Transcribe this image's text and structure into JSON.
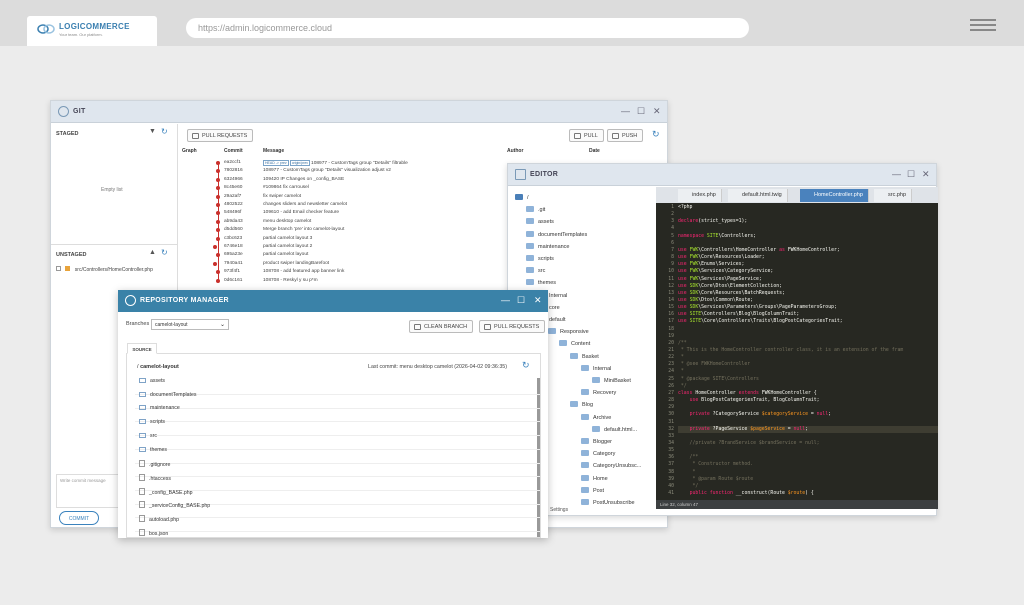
{
  "browser": {
    "logo": "LOGICOMMERCE",
    "logo_sub": "Your team. Our platform.",
    "url": "https://admin.logicommerce.cloud"
  },
  "git": {
    "title": "GIT",
    "staged": "STAGED",
    "empty": "Empty list",
    "unstaged": "UNSTAGED",
    "unstaged_file": "src/Controllers/HomeController.php",
    "commit_placeholder": "Write commit message",
    "commit_button": "COMMIT",
    "pull_requests": "PULL REQUESTS",
    "pull": "PULL",
    "push": "PUSH",
    "columns": [
      "Graph",
      "Commit",
      "Message",
      "Author",
      "Date"
    ],
    "commits": [
      {
        "hash": "ea2ccf1",
        "tags": [
          "HEAD -> prev",
          "origin/prev"
        ],
        "msg": "108977 - CustomTags group \"Details\" filtrable"
      },
      {
        "hash": "7802816",
        "tags": [],
        "msg": "108977 - CustomTags group \"Details\" visualization adjust v2"
      },
      {
        "hash": "6324966",
        "tags": [],
        "msg": "109420 IP Changes on _config_BASE"
      },
      {
        "hash": "8c45e60",
        "tags": [],
        "msg": "#109864 fix carrousel"
      },
      {
        "hash": "29a2af7",
        "tags": [],
        "msg": "fix swiper camelot"
      },
      {
        "hash": "4802522",
        "tags": [],
        "msg": "changes sliders and newsletter camelot"
      },
      {
        "hash": "548496f",
        "tags": [],
        "msg": "109610 - add Email checker feature"
      },
      {
        "hash": "ab9da43",
        "tags": [],
        "msg": "menu desktop camelot"
      },
      {
        "hash": "d5dd560",
        "tags": [],
        "msg": "Merge branch 'pre' into camelot-layout"
      },
      {
        "hash": "c3bc623",
        "tags": [],
        "msg": "partial camelot layout 3"
      },
      {
        "hash": "6746e18",
        "tags": [],
        "msg": "partial camelot layout 2"
      },
      {
        "hash": "695a23e",
        "tags": [],
        "msg": "partial camelot layout"
      },
      {
        "hash": "7940a41",
        "tags": [],
        "msg": "product swiper landingBarefoot"
      },
      {
        "hash": "973f4f1",
        "tags": [],
        "msg": "108708 - add featured app banner link"
      },
      {
        "hash": "0d6c161",
        "tags": [],
        "msg": "108708 - Reskyl y su p*m"
      }
    ]
  },
  "editor": {
    "title": "EDITOR",
    "tree": [
      {
        "label": "/",
        "depth": 0,
        "dark": true
      },
      {
        "label": ".git",
        "depth": 1
      },
      {
        "label": "assets",
        "depth": 1
      },
      {
        "label": "documentTemplates",
        "depth": 1
      },
      {
        "label": "maintenance",
        "depth": 1
      },
      {
        "label": "scripts",
        "depth": 1
      },
      {
        "label": "src",
        "depth": 1
      },
      {
        "label": "themes",
        "depth": 1
      },
      {
        "label": "Internal",
        "depth": 2
      },
      {
        "label": "core",
        "depth": 2
      },
      {
        "label": "default",
        "depth": 2
      },
      {
        "label": "Responsive",
        "depth": 3
      },
      {
        "label": "Content",
        "depth": 4
      },
      {
        "label": "Basket",
        "depth": 5
      },
      {
        "label": "Internal",
        "depth": 6
      },
      {
        "label": "MiniBasket",
        "depth": 7
      },
      {
        "label": "Recovery",
        "depth": 6
      },
      {
        "label": "Blog",
        "depth": 5
      },
      {
        "label": "Archive",
        "depth": 6
      },
      {
        "label": "default.html...",
        "depth": 7
      },
      {
        "label": "Blogger",
        "depth": 6
      },
      {
        "label": "Category",
        "depth": 6
      },
      {
        "label": "CategoryUnsubsc...",
        "depth": 6
      },
      {
        "label": "Home",
        "depth": 6
      },
      {
        "label": "Post",
        "depth": 6
      },
      {
        "label": "PostUnsubscribe",
        "depth": 6
      }
    ],
    "settings": "Settings",
    "tabs": [
      "index.php",
      "default.html.twig",
      "HomeController.php",
      "src.php"
    ],
    "status": "Line 32, column 47",
    "code": [
      [
        "1",
        "<?php"
      ],
      [
        "2",
        ""
      ],
      [
        "3",
        "declare(strict_types=1);"
      ],
      [
        "4",
        ""
      ],
      [
        "5",
        "namespace SITE\\Controllers;"
      ],
      [
        "6",
        ""
      ],
      [
        "7",
        "use FWK\\Controllers\\HomeController as FWKHomeController;"
      ],
      [
        "8",
        "use FWK\\Core\\Resources\\Loader;"
      ],
      [
        "9",
        "use FWK\\Enums\\Services;"
      ],
      [
        "10",
        "use FWK\\Services\\CategoryService;"
      ],
      [
        "11",
        "use FWK\\Services\\PageService;"
      ],
      [
        "12",
        "use SDK\\Core\\Dtos\\ElementCollection;"
      ],
      [
        "13",
        "use SDK\\Core\\Resources\\BatchRequests;"
      ],
      [
        "14",
        "use SDK\\Dtos\\Common\\Route;"
      ],
      [
        "15",
        "use SDK\\Services\\Parameters\\Groups\\PageParametersGroup;"
      ],
      [
        "16",
        "use SITE\\Controllers\\Blog\\BlogColumnTrait;"
      ],
      [
        "17",
        "use SITE\\Core\\Controllers\\Traits\\BlogPostCategoriesTrait;"
      ],
      [
        "18",
        ""
      ],
      [
        "19",
        ""
      ],
      [
        "20",
        "/**"
      ],
      [
        "21",
        " * This is the HomeController controller class, it is an extension of the fram"
      ],
      [
        "22",
        " *"
      ],
      [
        "23",
        " * @see FWKHomeController"
      ],
      [
        "24",
        " *"
      ],
      [
        "25",
        " * @package SITE\\Controllers"
      ],
      [
        "26",
        " */"
      ],
      [
        "27",
        "class HomeController extends FWKHomeController {"
      ],
      [
        "28",
        "    use BlogPostCategoriesTrait, BlogColumnTrait;"
      ],
      [
        "29",
        ""
      ],
      [
        "30",
        "    private ?CategoryService $categoryService = null;"
      ],
      [
        "31",
        ""
      ],
      [
        "32",
        "    private ?PageService $pageService = null;"
      ],
      [
        "33",
        ""
      ],
      [
        "34",
        "    //private ?BrandService $brandService = null;"
      ],
      [
        "35",
        ""
      ],
      [
        "36",
        "    /**"
      ],
      [
        "37",
        "     * Constructor method."
      ],
      [
        "38",
        "     *"
      ],
      [
        "39",
        "     * @param Route $route"
      ],
      [
        "40",
        "     */"
      ],
      [
        "41",
        "    public function __construct(Route $route) {"
      ]
    ]
  },
  "repo": {
    "title": "REPOSITORY MANAGER",
    "branches_label": "Branches",
    "branch": "camelot-layout",
    "clean": "CLEAN BRANCH",
    "pull_requests": "PULL REQUESTS",
    "source_tab": "SOURCE",
    "path": "/",
    "path_branch": "camelot-layout",
    "last_commit": "Last commit: menu desktop camelot (2026-04-02 09:36:35)",
    "items": [
      {
        "name": "assets",
        "type": "folder"
      },
      {
        "name": "documentTemplates",
        "type": "folder"
      },
      {
        "name": "maintenance",
        "type": "folder"
      },
      {
        "name": "scripts",
        "type": "folder"
      },
      {
        "name": "src",
        "type": "folder"
      },
      {
        "name": "themes",
        "type": "folder"
      },
      {
        "name": ".gitignore",
        "type": "file"
      },
      {
        "name": ".htaccess",
        "type": "file"
      },
      {
        "name": "_config_BASE.php",
        "type": "file"
      },
      {
        "name": "_serviceConfig_BASE.php",
        "type": "file"
      },
      {
        "name": "autoload.php",
        "type": "file"
      },
      {
        "name": "bos.json",
        "type": "file"
      }
    ]
  }
}
